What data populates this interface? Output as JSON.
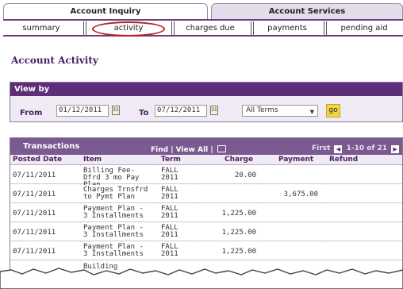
{
  "top_tabs": [
    "Account Inquiry",
    "Account Services"
  ],
  "subnav": [
    "summary",
    "activity",
    "charges due",
    "payments",
    "pending aid"
  ],
  "page_title": "Account Activity",
  "view_by": {
    "title": "View by",
    "from_label": "From",
    "from_value": "01/12/2011",
    "to_label": "To",
    "to_value": "07/12/2011",
    "terms_selected": "All Terms",
    "go_label": "go"
  },
  "transactions": {
    "title": "Transactions",
    "find_label": "Find",
    "view_all_label": "View All",
    "first_label": "First",
    "range_label": "1-10 of 21",
    "columns": [
      "Posted Date",
      "Item",
      "Term",
      "Charge",
      "Payment",
      "Refund"
    ],
    "rows": [
      {
        "date": "07/11/2011",
        "item": "Billing Fee-Dfrd 3 mo Pay Plan",
        "term": "FALL 2011",
        "charge": "20.00",
        "payment": ""
      },
      {
        "date": "07/11/2011",
        "item": "Charges Trnsfrd to Pymt Plan",
        "term": "FALL 2011",
        "charge": "",
        "payment": "3,675.00"
      },
      {
        "date": "07/11/2011",
        "item": "Payment Plan - 3 Installments",
        "term": "FALL 2011",
        "charge": "1,225.00",
        "payment": ""
      },
      {
        "date": "07/11/2011",
        "item": "Payment Plan - 3 Installments",
        "term": "FALL 2011",
        "charge": "1,225.00",
        "payment": ""
      },
      {
        "date": "07/11/2011",
        "item": "Payment Plan - 3 Installments",
        "term": "FALL 2011",
        "charge": "1,225.00",
        "payment": ""
      }
    ],
    "partial_row_text": "Building"
  },
  "colors": {
    "accent": "#5d2f78",
    "header_light": "#7a5a90",
    "highlight_oval": "#b22222",
    "go_button": "#f0d34a"
  }
}
